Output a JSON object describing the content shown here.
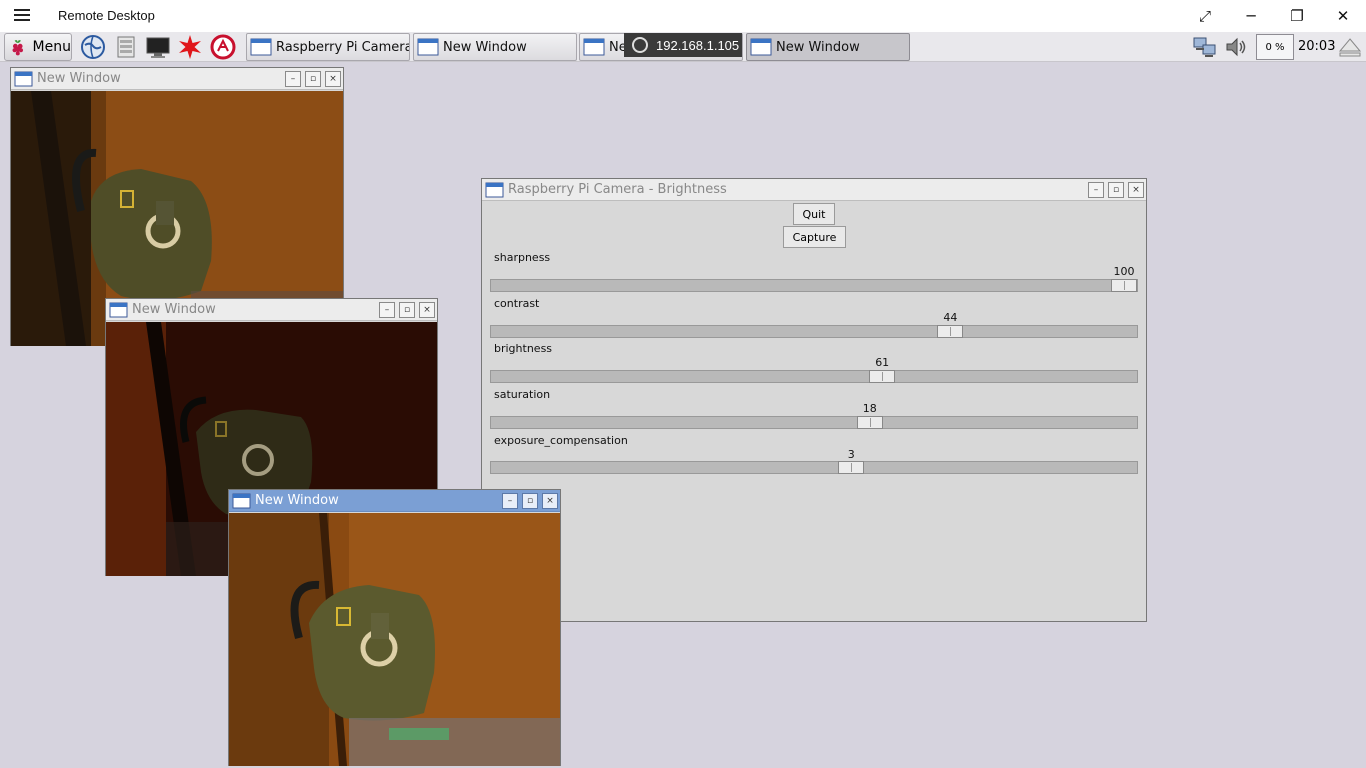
{
  "remote_desktop": {
    "title": "Remote Desktop",
    "connection_address": "192.168.1.105"
  },
  "panel": {
    "menu_label": "Menu",
    "launchers": [
      "web-browser-icon",
      "file-manager-icon",
      "terminal-icon",
      "math-app-icon",
      "wolfram-icon"
    ],
    "tasks": [
      {
        "label": "Raspberry Pi Camera ...",
        "active": false
      },
      {
        "label": "New Window",
        "active": false
      },
      {
        "label": "New Window",
        "active": false
      },
      {
        "label": "New Window",
        "active": true
      }
    ],
    "cpu_label": "0 %",
    "clock": "20:03"
  },
  "windows": {
    "preview1": {
      "title": "New Window"
    },
    "preview2": {
      "title": "New Window"
    },
    "preview3": {
      "title": "New Window"
    },
    "control": {
      "title": "Raspberry Pi Camera - Brightness"
    }
  },
  "controls": {
    "quit_label": "Quit",
    "capture_label": "Capture",
    "sliders": [
      {
        "label": "sharpness",
        "value": "100",
        "fraction": 1.0
      },
      {
        "label": "contrast",
        "value": "44",
        "fraction": 0.72
      },
      {
        "label": "brightness",
        "value": "61",
        "fraction": 0.61
      },
      {
        "label": "saturation",
        "value": "18",
        "fraction": 0.59
      },
      {
        "label": "exposure_compensation",
        "value": "3",
        "fraction": 0.56
      }
    ]
  },
  "colors": {
    "desktop": "#d6d3de",
    "focused_titlebar": "#7b9fd4",
    "photo_wood": "#8a4a12",
    "bag": "#5b5a2e"
  }
}
